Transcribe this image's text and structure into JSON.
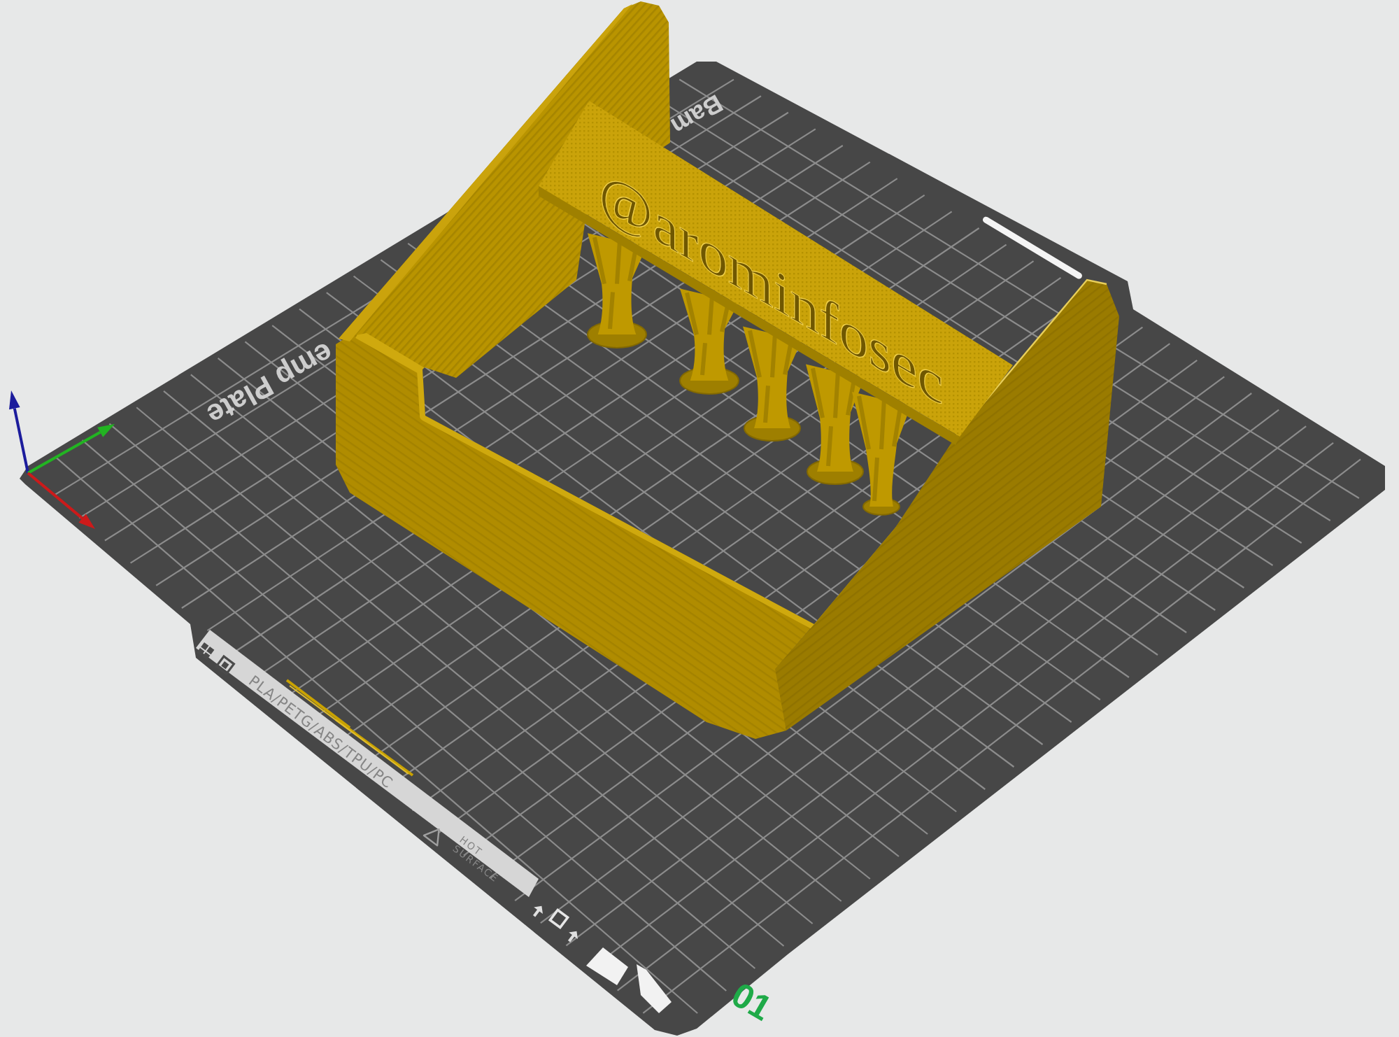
{
  "plate": {
    "brand_text": "Bam",
    "name_text": "emp Plate",
    "materials_text": "PLA/PETG/ABS/TPU/PC",
    "warning_lines": [
      "HOT",
      "SURFACE"
    ],
    "plate_number": "01"
  },
  "model": {
    "embossed_text": "@arominfosec"
  }
}
